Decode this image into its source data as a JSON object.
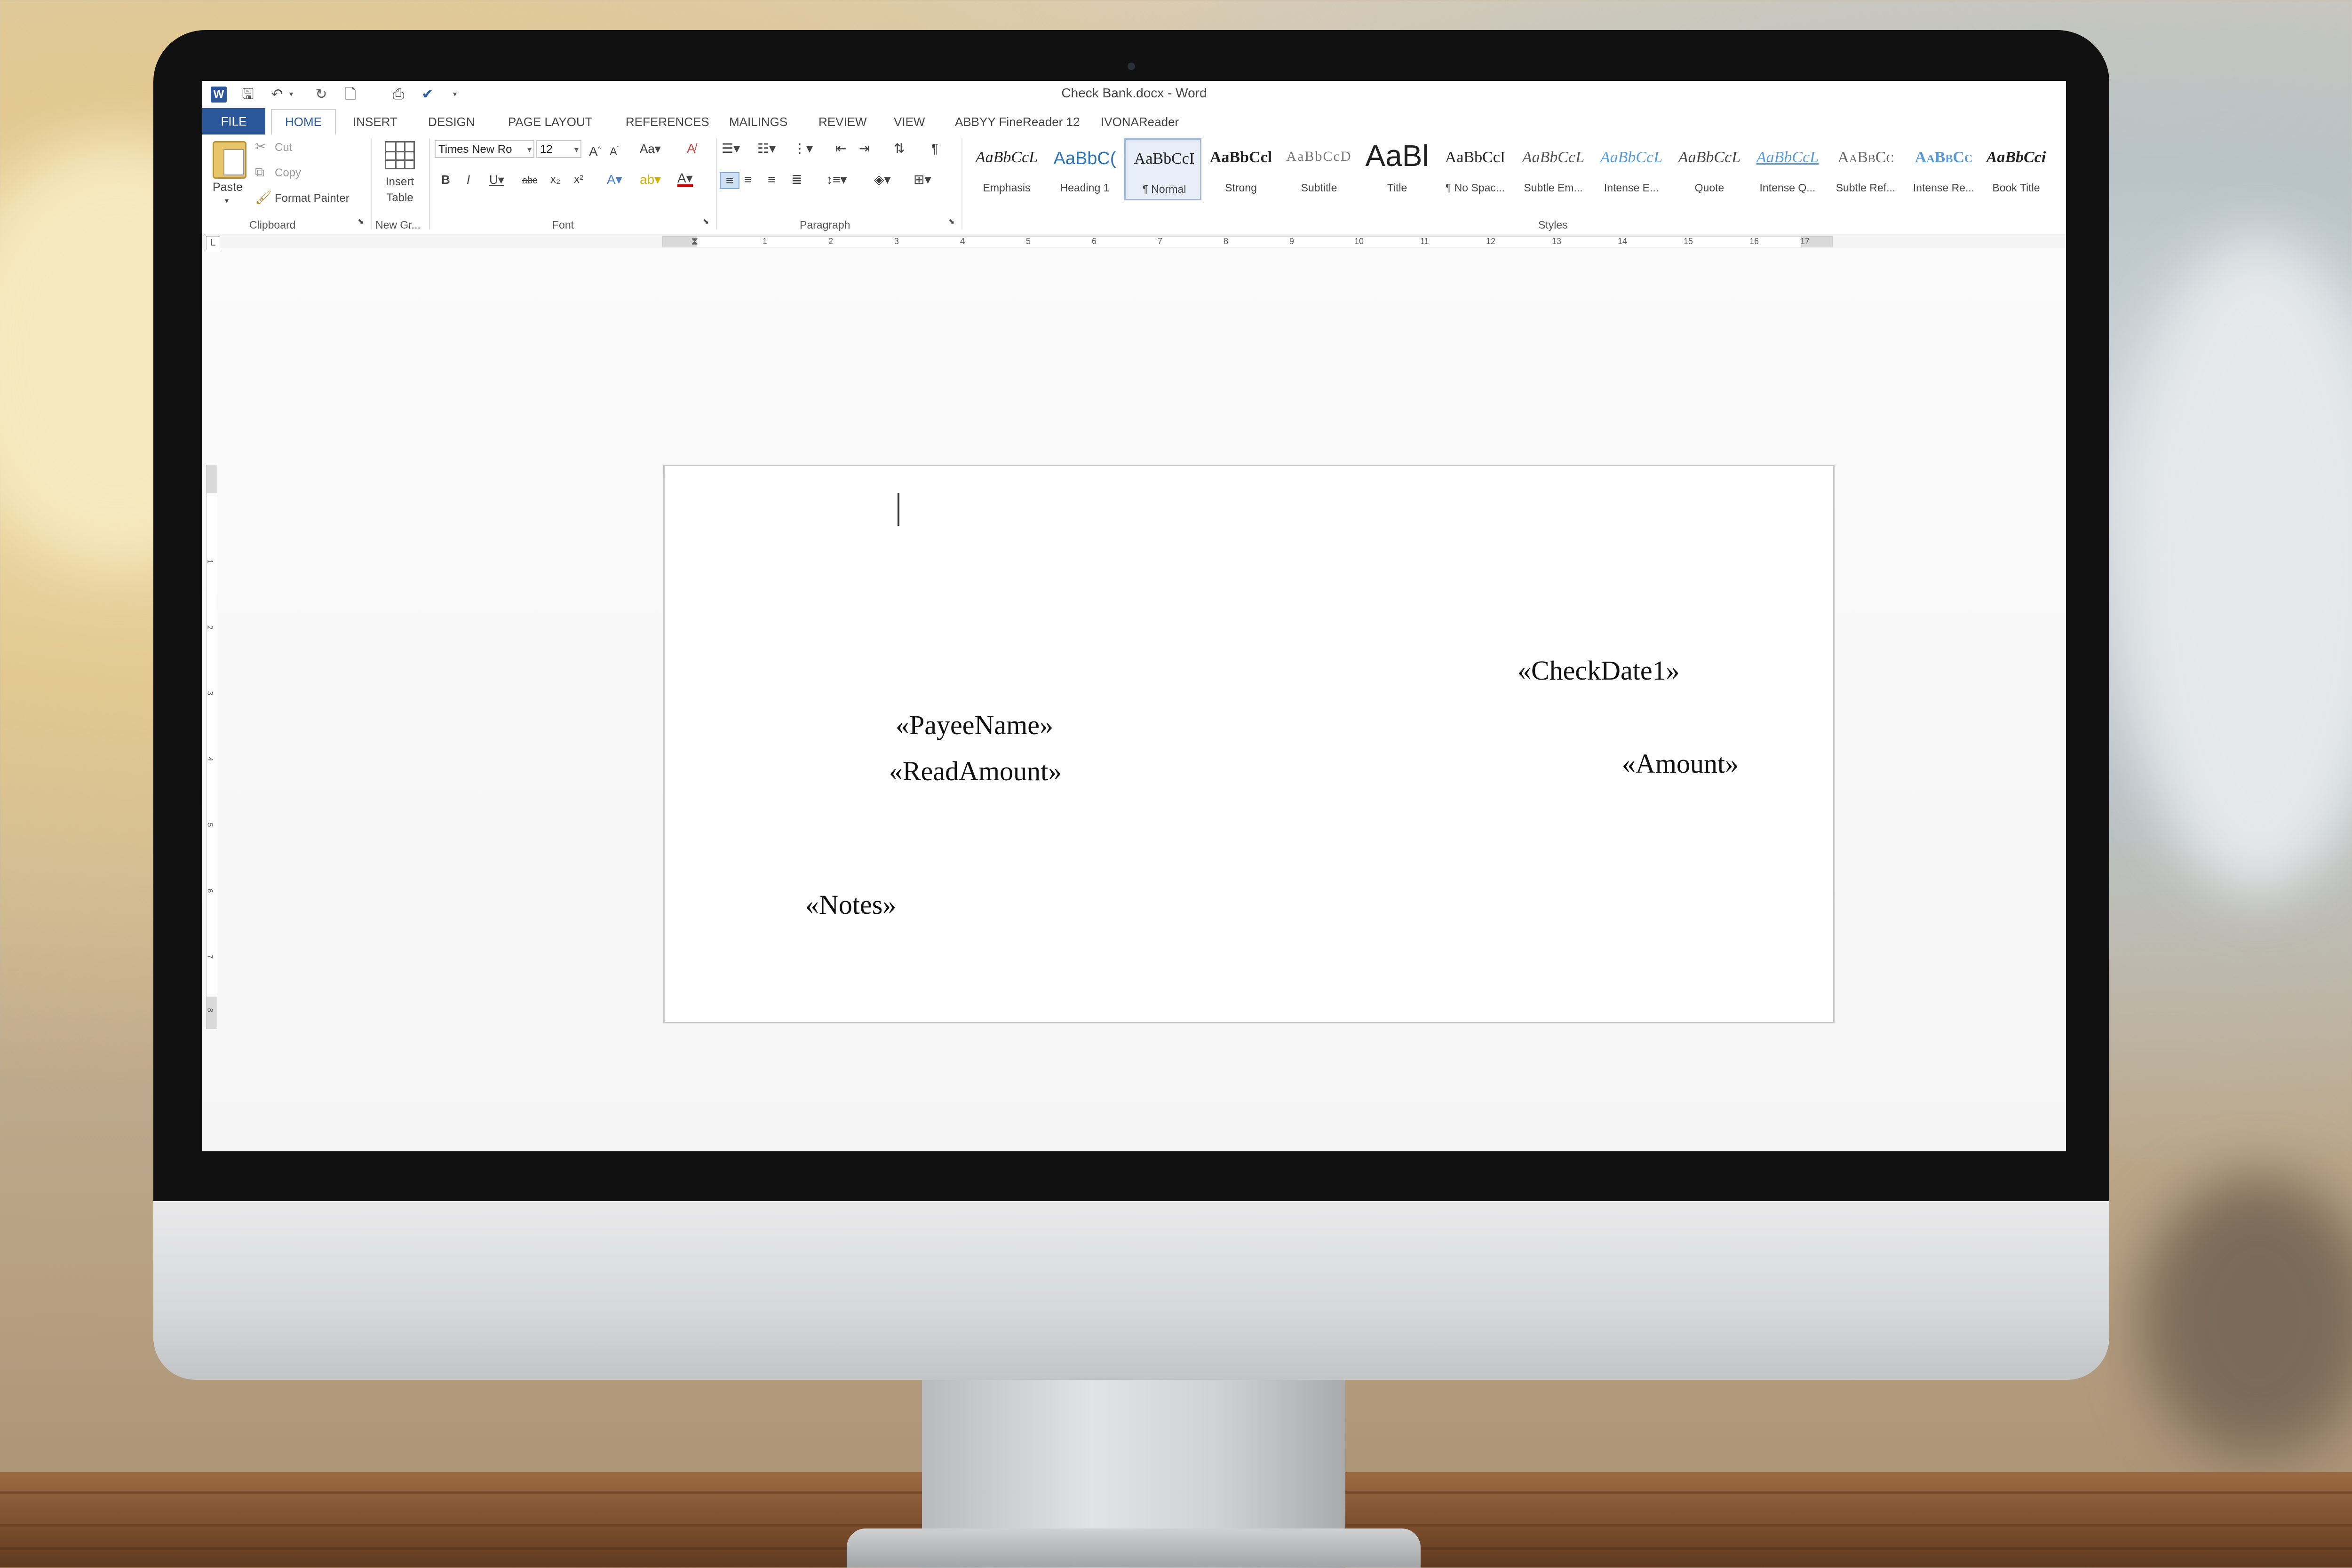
{
  "window": {
    "title": "Check Bank.docx - Word"
  },
  "tabs": [
    {
      "label": "FILE"
    },
    {
      "label": "HOME"
    },
    {
      "label": "INSERT"
    },
    {
      "label": "DESIGN"
    },
    {
      "label": "PAGE LAYOUT"
    },
    {
      "label": "REFERENCES"
    },
    {
      "label": "MAILINGS"
    },
    {
      "label": "REVIEW"
    },
    {
      "label": "VIEW"
    },
    {
      "label": "ABBYY FineReader 12"
    },
    {
      "label": "IVONAReader"
    }
  ],
  "clipboard": {
    "paste": "Paste",
    "cut": "Cut",
    "copy": "Copy",
    "format_painter": "Format Painter",
    "label": "Clipboard"
  },
  "new_group": {
    "insert_table": "Insert Table",
    "label": "New Gr..."
  },
  "font": {
    "family": "Times New Ro",
    "size": "12",
    "label": "Font"
  },
  "paragraph": {
    "label": "Paragraph"
  },
  "styles": {
    "label": "Styles",
    "items": [
      {
        "sample": "AaBbCcL",
        "name": "Emphasis"
      },
      {
        "sample": "AaBbC(",
        "name": "Heading 1"
      },
      {
        "sample": "AaBbCcI",
        "name": "¶ Normal"
      },
      {
        "sample": "AaBbCcl",
        "name": "Strong"
      },
      {
        "sample": "AaBbCcD",
        "name": "Subtitle"
      },
      {
        "sample": "AaBl",
        "name": "Title"
      },
      {
        "sample": "AaBbCcI",
        "name": "¶ No Spac..."
      },
      {
        "sample": "AaBbCcL",
        "name": "Subtle Em..."
      },
      {
        "sample": "AaBbCcL",
        "name": "Intense E..."
      },
      {
        "sample": "AaBbCcL",
        "name": "Quote"
      },
      {
        "sample": "AaBbCcL",
        "name": "Intense Q..."
      },
      {
        "sample": "AaBbCc",
        "name": "Subtle Ref..."
      },
      {
        "sample": "AaBbCc",
        "name": "Intense Re..."
      },
      {
        "sample": "AaBbCci",
        "name": "Book Title"
      }
    ]
  },
  "ruler": {
    "h_numbers": [
      "1",
      "2",
      "3",
      "4",
      "5",
      "6",
      "7",
      "8",
      "9",
      "10",
      "11",
      "12",
      "13",
      "14",
      "15",
      "16",
      "17"
    ],
    "v_numbers": [
      "1",
      "2",
      "3",
      "4",
      "5",
      "6",
      "7",
      "8"
    ]
  },
  "document": {
    "fields": {
      "check_date": "«CheckDate1»",
      "payee_name": "«PayeeName»",
      "read_amount": "«ReadAmount»",
      "amount": "«Amount»",
      "notes": "«Notes»"
    }
  },
  "colors": {
    "word_blue": "#2b579a",
    "heading_blue": "#2e74b5"
  }
}
